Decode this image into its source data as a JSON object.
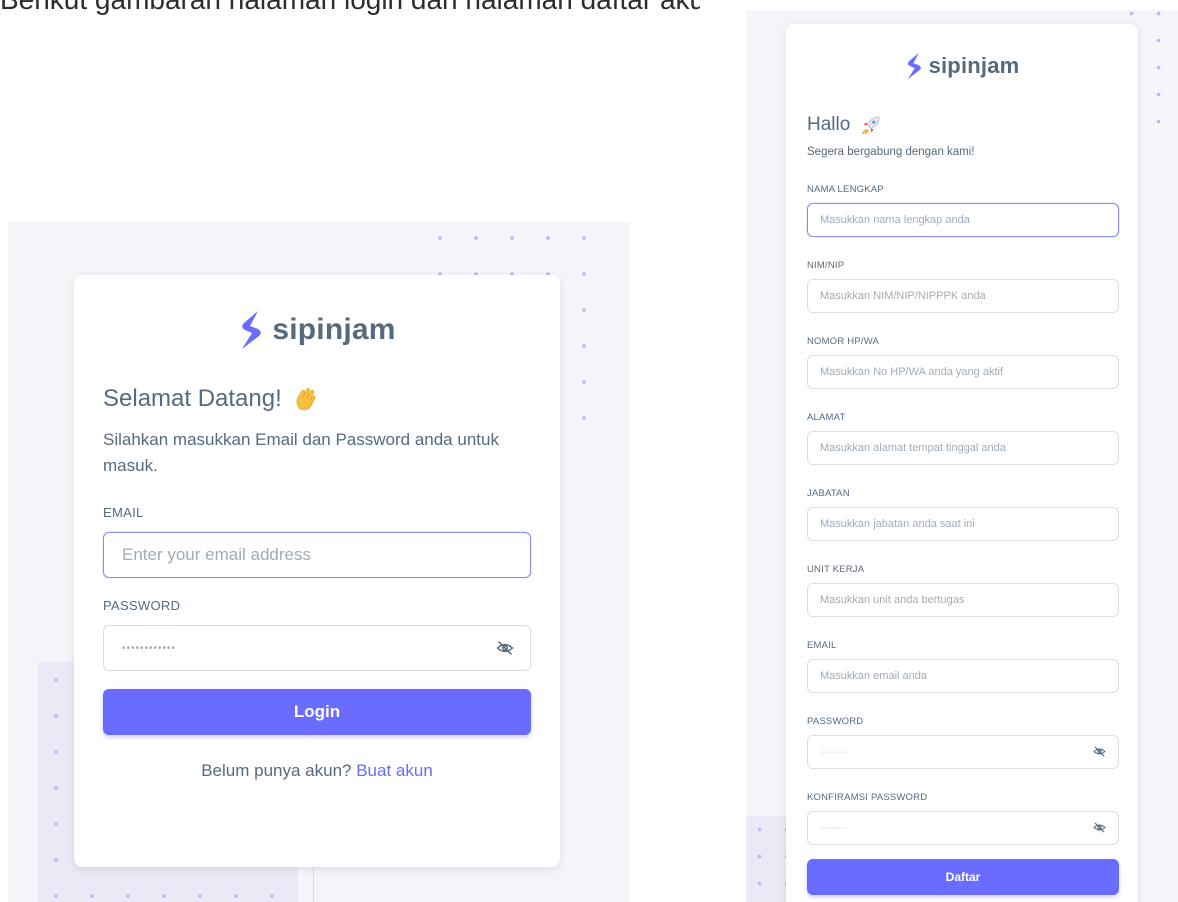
{
  "top_text": "Berikut gambaran halaman login dan halaman daftar akun pada aplikasi sipinjam:",
  "brand": {
    "name": "sipinjam",
    "logo_icon": "s-bolt-logo-icon",
    "color": "#696cff"
  },
  "login": {
    "title": "Selamat Datang!",
    "title_emoji": "👋",
    "subtitle": "Silahkan masukkan Email dan Password anda untuk masuk.",
    "email_label": "EMAIL",
    "email_placeholder": "Enter your email address",
    "password_label": "PASSWORD",
    "password_value": "••••••••••••",
    "password_icon": "eye-off-icon",
    "login_button": "Login",
    "footer_text": "Belum punya akun?",
    "footer_link": "Buat akun"
  },
  "register": {
    "title": "Hallo",
    "title_emoji": "🚀",
    "subtitle": "Segera bergabung dengan kami!",
    "fields": [
      {
        "label": "NAMA LENGKAP",
        "placeholder": "Masukkan nama lengkap anda"
      },
      {
        "label": "NIM/NIP",
        "placeholder": "Masukkan NIM/NIP/NIPPPK anda"
      },
      {
        "label": "NOMOR HP/WA",
        "placeholder": "Masukkan No HP/WA anda yang aktif"
      },
      {
        "label": "ALAMAT",
        "placeholder": "Masukkan alamat tempat tinggal anda"
      },
      {
        "label": "JABATAN",
        "placeholder": "Masukkan jabatan anda saat ini"
      },
      {
        "label": "UNIT KERJA",
        "placeholder": "Masukkan unit anda bertugas"
      },
      {
        "label": "EMAIL",
        "placeholder": "Masukkan email anda"
      },
      {
        "label": "PASSWORD",
        "placeholder": "············"
      },
      {
        "label": "KONFIRAMSI PASSWORD",
        "placeholder": "············"
      }
    ],
    "submit_button": "Daftar"
  },
  "colors": {
    "primary": "#696cff",
    "text": "#566a7f",
    "placeholder": "#a1acb8",
    "background": "#f5f5f9"
  }
}
